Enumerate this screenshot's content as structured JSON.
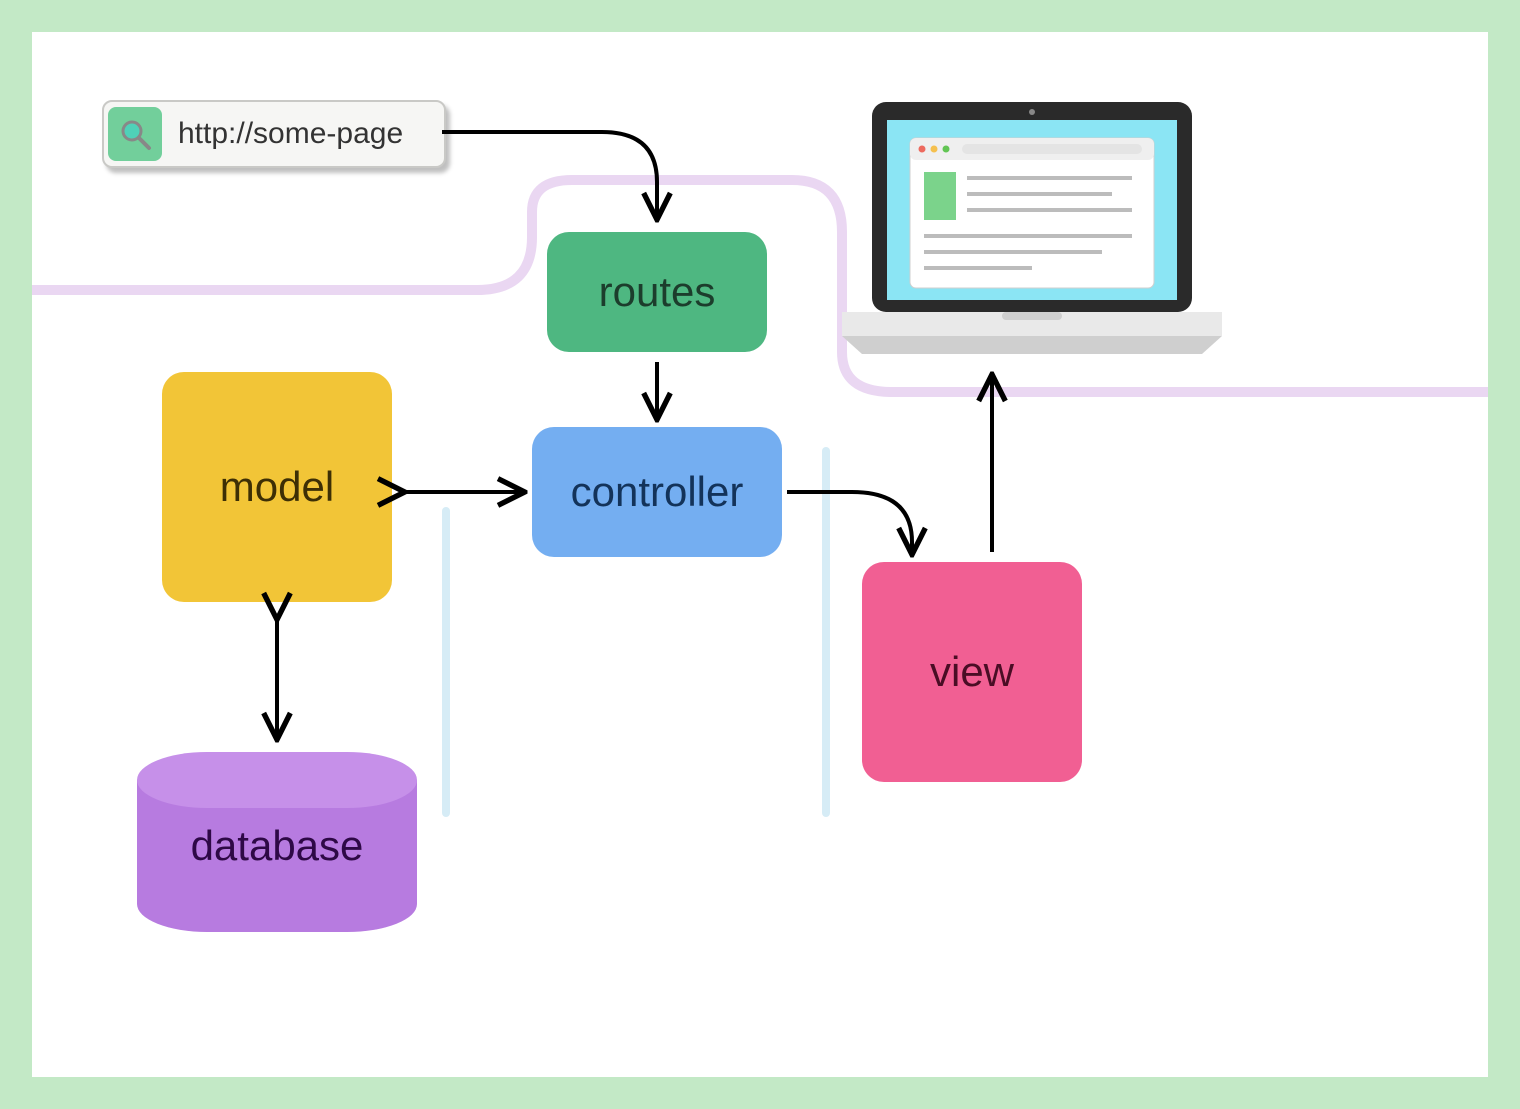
{
  "diagram": {
    "url_text": "http://some-page",
    "nodes": {
      "routes": "routes",
      "controller": "controller",
      "model": "model",
      "view": "view",
      "database": "database"
    },
    "edges": [
      {
        "from": "url",
        "to": "routes",
        "bidirectional": false
      },
      {
        "from": "routes",
        "to": "controller",
        "bidirectional": false
      },
      {
        "from": "controller",
        "to": "model",
        "bidirectional": true
      },
      {
        "from": "model",
        "to": "database",
        "bidirectional": true
      },
      {
        "from": "controller",
        "to": "view",
        "bidirectional": false
      },
      {
        "from": "view",
        "to": "laptop",
        "bidirectional": false
      }
    ],
    "colors": {
      "routes": "#4eb781",
      "controller": "#74aef1",
      "model": "#f2c537",
      "view": "#f15f93",
      "database": "#b77be0",
      "frame": "#c3e9c6"
    }
  }
}
